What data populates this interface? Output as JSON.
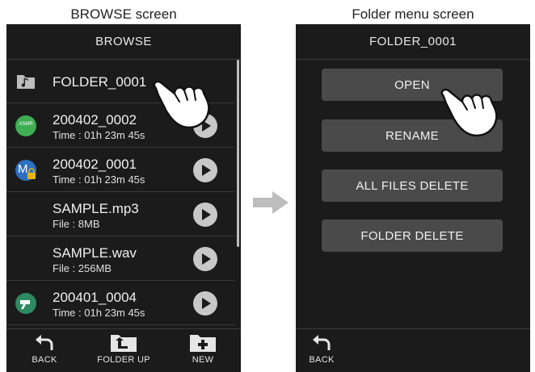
{
  "captions": {
    "left": "BROWSE screen",
    "right": "Folder menu screen"
  },
  "browse": {
    "header": "BROWSE",
    "items": [
      {
        "name": "FOLDER_0001",
        "sub": "",
        "icon": "folder-music-icon"
      },
      {
        "name": "200402_0002",
        "sub": "Time : 01h 23m 45s",
        "icon": "asmr-badge-icon",
        "badge_text": "ASMR",
        "badge_color": "#3fae52"
      },
      {
        "name": "200402_0001",
        "sub": "Time : 01h 23m 45s",
        "icon": "m-badge-lock-icon",
        "badge_text": "M",
        "badge_color": "#2d6fc1"
      },
      {
        "name": "SAMPLE.mp3",
        "sub": "File : 8MB",
        "icon": ""
      },
      {
        "name": "SAMPLE.wav",
        "sub": "File : 256MB",
        "icon": ""
      },
      {
        "name": "200401_0004",
        "sub": "Time : 01h 23m 45s",
        "icon": "mic-badge-icon",
        "badge_color": "#2e8a62"
      }
    ],
    "footer": {
      "back": "BACK",
      "folder_up": "FOLDER UP",
      "new": "NEW"
    }
  },
  "folder": {
    "header": "FOLDER_0001",
    "buttons": [
      "OPEN",
      "RENAME",
      "ALL FILES DELETE",
      "FOLDER DELETE"
    ],
    "footer": {
      "back": "BACK"
    }
  },
  "colors": {
    "screen_bg": "#1b1b1b",
    "divider": "#3a3a3a",
    "menu_button": "#4a4a4a",
    "play_button": "#c8c8c8",
    "arrow": "#bdbdbd"
  }
}
